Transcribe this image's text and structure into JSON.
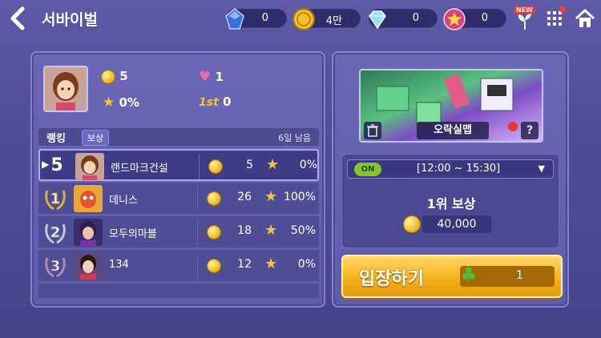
{
  "header": {
    "title": "서바이벌",
    "currencies": [
      {
        "name": "gem-blue",
        "value": "0"
      },
      {
        "name": "gold-coin",
        "value": "4만"
      },
      {
        "name": "diamond",
        "value": "0"
      },
      {
        "name": "star-token",
        "value": "0"
      }
    ],
    "new_badge": "NEW"
  },
  "profile": {
    "coins": "5",
    "hearts": "1",
    "star_pct": "0%",
    "first_label": "1st",
    "first_count": "0"
  },
  "ranking": {
    "label": "랭킹",
    "reward_tab": "보상",
    "days_left": "6일 남음",
    "rows": [
      {
        "rank": "5",
        "name": "랜드마크건설",
        "score": "5",
        "pct": "0%"
      },
      {
        "rank": "1",
        "name": "데니스",
        "score": "26",
        "pct": "100%"
      },
      {
        "rank": "2",
        "name": "모두의마블",
        "score": "18",
        "pct": "50%"
      },
      {
        "rank": "3",
        "name": "134",
        "score": "12",
        "pct": "0%"
      }
    ]
  },
  "map": {
    "name": "오락실맵",
    "help": "?"
  },
  "schedule": {
    "on_label": "ON",
    "time": "[12:00 ~ 15:30]",
    "reward_title": "1위 보상",
    "reward_amount": "40,000"
  },
  "enter": {
    "label": "입장하기",
    "clover_count": "1"
  },
  "colors": {
    "background": "#4f4d98",
    "panel": "#6a68b6",
    "accent_gold": "#f6b21a",
    "on_green": "#86c531"
  }
}
